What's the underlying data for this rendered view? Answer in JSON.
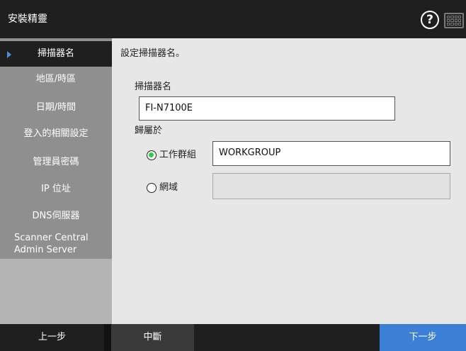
{
  "window": {
    "title": "安裝精靈"
  },
  "header": {
    "help_icon": "question-circle-icon",
    "keyboard_icon": "keyboard-icon"
  },
  "sidebar": {
    "items": [
      {
        "label": "掃描器名",
        "active": true
      },
      {
        "label": "地區/時區"
      },
      {
        "label": "日期/時間"
      },
      {
        "label": "登入的相關設定"
      },
      {
        "label": "管理員密碼"
      },
      {
        "label": "IP 位址"
      },
      {
        "label": "DNS伺服器"
      },
      {
        "label_line1": "Scanner Central",
        "label_line2": "Admin Server"
      }
    ]
  },
  "main": {
    "instruction": "設定掃描器名。",
    "scanner_name_label": "掃描器名",
    "scanner_name_value": "FI-N7100E",
    "belongs_to_label": "歸屬於",
    "workgroup_option_label": "工作群組",
    "workgroup_value": "WORKGROUP",
    "domain_option_label": "網域",
    "domain_value": ""
  },
  "footer": {
    "back_label": "上一步",
    "cancel_label": "中斷",
    "next_label": "下一步"
  },
  "colors": {
    "accent": "#3b7fd6",
    "radio_selected": "#2ecc40",
    "titlebar": "#1f1f1f",
    "sidebar": "#8f8f8f"
  }
}
